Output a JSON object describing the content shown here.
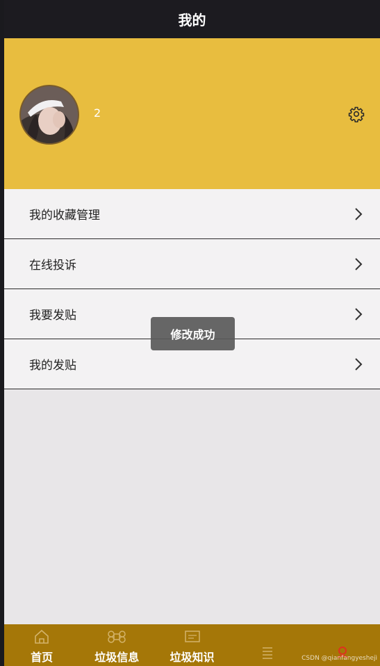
{
  "header": {
    "title": "我的"
  },
  "profile": {
    "username": "2"
  },
  "menu": {
    "items": [
      {
        "label": "我的收藏管理"
      },
      {
        "label": "在线投诉"
      },
      {
        "label": "我要发贴"
      },
      {
        "label": "我的发贴"
      }
    ]
  },
  "toast": {
    "text": "修改成功"
  },
  "tabbar": {
    "items": [
      {
        "label": "首页",
        "icon": "home-icon"
      },
      {
        "label": "垃圾信息",
        "icon": "command-icon"
      },
      {
        "label": "垃圾知识",
        "icon": "monitor-icon"
      },
      {
        "label": "",
        "icon": "list-icon"
      },
      {
        "label": "",
        "icon": "user-icon",
        "active": true
      }
    ]
  },
  "watermark": {
    "text": "CSDN @qianfangyeshejì"
  },
  "colors": {
    "accent": "#e8bd3f",
    "tabbar": "#a57708",
    "active_icon": "#e0301e"
  }
}
